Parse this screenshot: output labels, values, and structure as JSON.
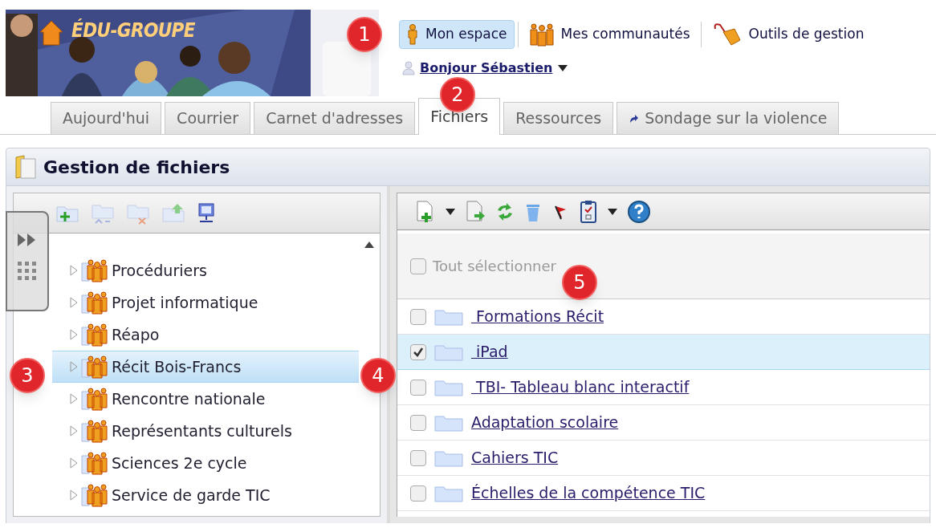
{
  "header": {
    "logo": "ÉDU-GROUPE",
    "nav": [
      {
        "label": "Mon espace",
        "selected": true,
        "kind": "person"
      },
      {
        "label": "Mes communautés",
        "selected": false,
        "kind": "group"
      },
      {
        "label": "Outils de gestion",
        "selected": false,
        "kind": "tools"
      }
    ],
    "greeting": "Bonjour Sébastien"
  },
  "tabs": [
    {
      "label": "Aujourd'hui",
      "selected": false
    },
    {
      "label": "Courrier",
      "selected": false
    },
    {
      "label": "Carnet d'adresses",
      "selected": false
    },
    {
      "label": "Fichiers",
      "selected": true
    },
    {
      "label": "Ressources",
      "selected": false
    },
    {
      "label": "Sondage sur la violence",
      "selected": false,
      "kind": "link"
    }
  ],
  "panel": {
    "title": "Gestion de fichiers"
  },
  "tree": {
    "items": [
      {
        "label": "Procéduriers",
        "selected": false
      },
      {
        "label": "Projet informatique",
        "selected": false
      },
      {
        "label": "Réapo",
        "selected": false
      },
      {
        "label": "Récit Bois-Francs",
        "selected": true
      },
      {
        "label": "Rencontre nationale",
        "selected": false
      },
      {
        "label": "Représentants culturels",
        "selected": false
      },
      {
        "label": "Sciences 2e cycle",
        "selected": false
      },
      {
        "label": "Service de garde TIC",
        "selected": false
      }
    ]
  },
  "files": {
    "select_all": {
      "label": "Tout sélectionner",
      "checked": false
    },
    "rows": [
      {
        "name": " Formations Récit",
        "checked": false,
        "selected": false
      },
      {
        "name": " iPad",
        "checked": true,
        "selected": true
      },
      {
        "name": " TBI- Tableau blanc interactif",
        "checked": false,
        "selected": false
      },
      {
        "name": "Adaptation scolaire",
        "checked": false,
        "selected": false
      },
      {
        "name": "Cahiers TIC",
        "checked": false,
        "selected": false
      },
      {
        "name": "Échelles de la compétence TIC",
        "checked": false,
        "selected": false
      }
    ]
  },
  "callouts": [
    "1",
    "2",
    "3",
    "4",
    "5"
  ]
}
